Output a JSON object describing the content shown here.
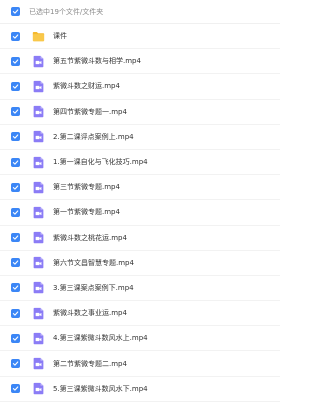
{
  "header": {
    "selection_text": "已选中19个文件/文件夹"
  },
  "colors": {
    "checkbox": "#3b86f6",
    "folder": "#f9c84a",
    "video_icon": "#8b7cf6"
  },
  "items": [
    {
      "name": "课件",
      "type": "folder",
      "icon": "folder-icon"
    },
    {
      "name": "第五节紫微斗数与相学.mp4",
      "type": "video",
      "icon": "video-icon"
    },
    {
      "name": "紫微斗数之财运.mp4",
      "type": "video",
      "icon": "video-icon"
    },
    {
      "name": "第四节紫微专题一.mp4",
      "type": "video",
      "icon": "video-icon"
    },
    {
      "name": "2.第二课评点案例上.mp4",
      "type": "video",
      "icon": "video-icon"
    },
    {
      "name": "1.第一课自化与飞化技巧.mp4",
      "type": "video",
      "icon": "video-icon"
    },
    {
      "name": "第三节紫微专题.mp4",
      "type": "video",
      "icon": "video-icon"
    },
    {
      "name": "第一节紫微专题.mp4",
      "type": "video",
      "icon": "video-icon"
    },
    {
      "name": "紫微斗数之桃花运.mp4",
      "type": "video",
      "icon": "video-icon"
    },
    {
      "name": "第六节文昌智慧专题.mp4",
      "type": "video",
      "icon": "video-icon"
    },
    {
      "name": "3.第三课案点案例下.mp4",
      "type": "video",
      "icon": "video-icon"
    },
    {
      "name": "紫微斗数之事业运.mp4",
      "type": "video",
      "icon": "video-icon"
    },
    {
      "name": "4.第三课紫微斗数风水上.mp4",
      "type": "video",
      "icon": "video-icon"
    },
    {
      "name": "第二节紫微专题二.mp4",
      "type": "video",
      "icon": "video-icon"
    },
    {
      "name": "5.第三课紫微斗数风水下.mp4",
      "type": "video",
      "icon": "video-icon"
    }
  ]
}
